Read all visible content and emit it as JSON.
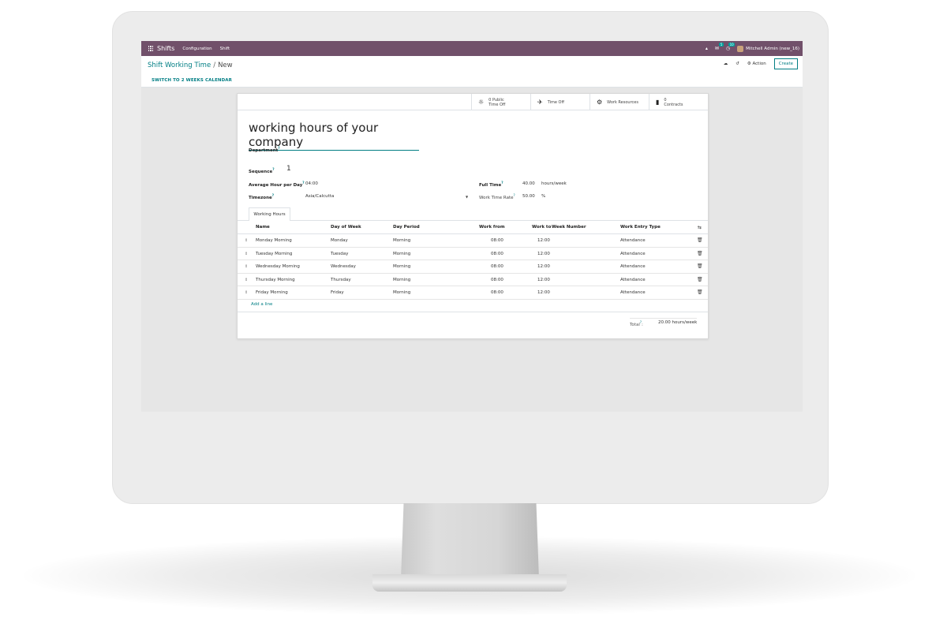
{
  "navbar": {
    "brand": "Shifts",
    "menu": [
      "Configuration",
      "Shift"
    ],
    "messages_badge": "5",
    "activities_badge": "10",
    "user": "Mitchell Admin (new_16)"
  },
  "control_panel": {
    "breadcrumb_parent": "Shift Working Time",
    "breadcrumb_separator": "/",
    "breadcrumb_current": "New",
    "action_label": "Action",
    "create_label": "Create",
    "switch_calendar": "SWITCH TO 2 WEEKS CALENDAR"
  },
  "smart_buttons": [
    {
      "icon": "public-holiday-icon",
      "line1": "0 Public",
      "line2": "Time Off"
    },
    {
      "icon": "plane-icon",
      "line1": "Time Off",
      "line2": ""
    },
    {
      "icon": "cogs-icon",
      "line1": "Work Resources",
      "line2": ""
    },
    {
      "icon": "book-icon",
      "line1": "0",
      "line2": "Contracts"
    }
  ],
  "form": {
    "name": "working hours of your company",
    "department_label": "Department",
    "sequence_label": "Sequence",
    "sequence_value": "1",
    "avg_hour_label": "Average Hour per Day",
    "avg_hour_value": "04:00",
    "timezone_label": "Timezone",
    "timezone_value": "Asia/Calcutta",
    "full_time_label": "Full Time",
    "full_time_value": "40.00",
    "full_time_unit": "hours/week",
    "work_rate_label": "Work Time Rate",
    "work_rate_value": "50.00",
    "work_rate_unit": "%"
  },
  "tab_label": "Working Hours",
  "table": {
    "columns": [
      "Name",
      "Day of Week",
      "Day Period",
      "Work from",
      "Work to",
      "Week Number",
      "Work Entry Type"
    ],
    "rows": [
      {
        "name": "Monday Morning",
        "day": "Monday",
        "period": "Morning",
        "from": "08:00",
        "to": "12:00",
        "type": "Attendance"
      },
      {
        "name": "Tuesday Morning",
        "day": "Tuesday",
        "period": "Morning",
        "from": "08:00",
        "to": "12:00",
        "type": "Attendance"
      },
      {
        "name": "Wednesday Morning",
        "day": "Wednesday",
        "period": "Morning",
        "from": "08:00",
        "to": "12:00",
        "type": "Attendance"
      },
      {
        "name": "Thursday Morning",
        "day": "Thursday",
        "period": "Morning",
        "from": "08:00",
        "to": "12:00",
        "type": "Attendance"
      },
      {
        "name": "Friday Morning",
        "day": "Friday",
        "period": "Morning",
        "from": "08:00",
        "to": "12:00",
        "type": "Attendance"
      }
    ],
    "add_line": "Add a line",
    "total_label": "Total",
    "total_value": "20.00",
    "total_unit": "hours/week"
  },
  "colors": {
    "navbar": "#71506a",
    "accent": "#017e84"
  }
}
